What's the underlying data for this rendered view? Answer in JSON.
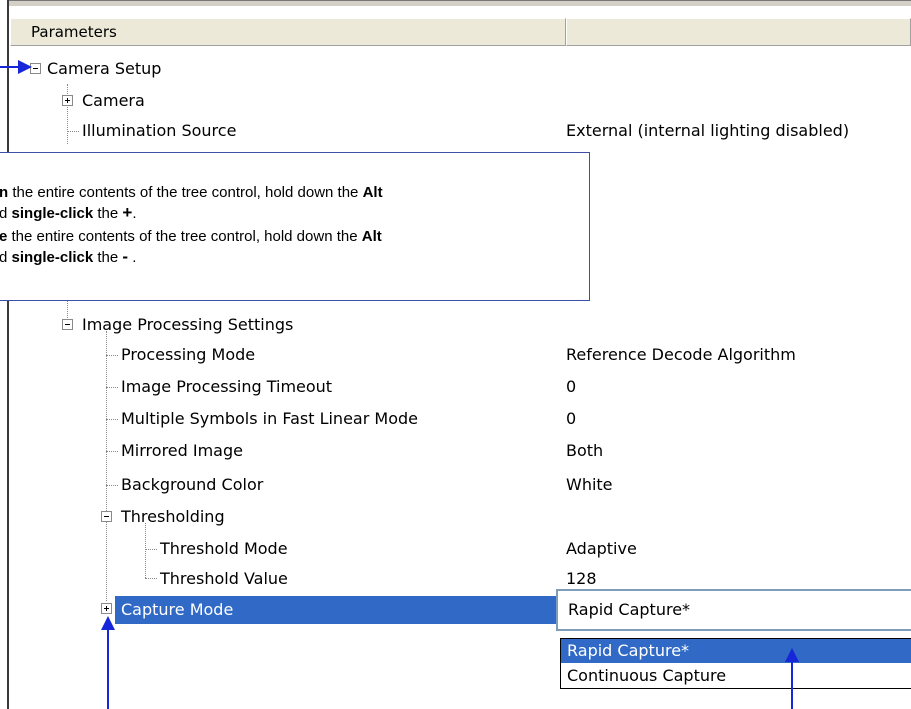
{
  "header": {
    "col1": "Parameters",
    "col2": ""
  },
  "tree": {
    "camera_setup": "Camera Setup",
    "camera": "Camera",
    "illumination_source": {
      "label": "Illumination Source",
      "value": "External (internal lighting disabled)"
    },
    "image_processing_settings": "Image Processing Settings",
    "processing_mode": {
      "label": "Processing Mode",
      "value": "Reference Decode Algorithm"
    },
    "image_processing_timeout": {
      "label": "Image Processing Timeout",
      "value": "0"
    },
    "multiple_symbols": {
      "label": "Multiple Symbols in Fast Linear Mode",
      "value": "0"
    },
    "mirrored_image": {
      "label": "Mirrored Image",
      "value": "Both"
    },
    "background_color": {
      "label": "Background Color",
      "value": "White"
    },
    "thresholding": "Thresholding",
    "threshold_mode": {
      "label": "Threshold Mode",
      "value": "Adaptive"
    },
    "threshold_value": {
      "label": "Threshold Value",
      "value": "128"
    },
    "capture_mode": "Capture Mode"
  },
  "capture_mode_dropdown": {
    "selected": "Rapid Capture*",
    "options": [
      "Rapid Capture*",
      "Continuous Capture"
    ]
  },
  "callout": {
    "line1_bold_start": "n",
    "line1_rest": " the entire contents of the tree control, hold down the ",
    "line1_bold_end": "Alt",
    "line2_prefix": "d ",
    "line2_bold": "single-click",
    "line2_mid": " the ",
    "line2_symbol": "+",
    "line2_end": ".",
    "line3_bold_start": "e",
    "line3_rest": " the entire contents of the tree control, hold down the ",
    "line3_bold_end": "Alt",
    "line4_prefix": "d ",
    "line4_bold": "single-click",
    "line4_mid": " the ",
    "line4_symbol": "-",
    "line4_end": " ."
  },
  "colors": {
    "selection": "#3169c6",
    "arrow": "#1826d9",
    "callout_border": "#3d4fa6"
  }
}
